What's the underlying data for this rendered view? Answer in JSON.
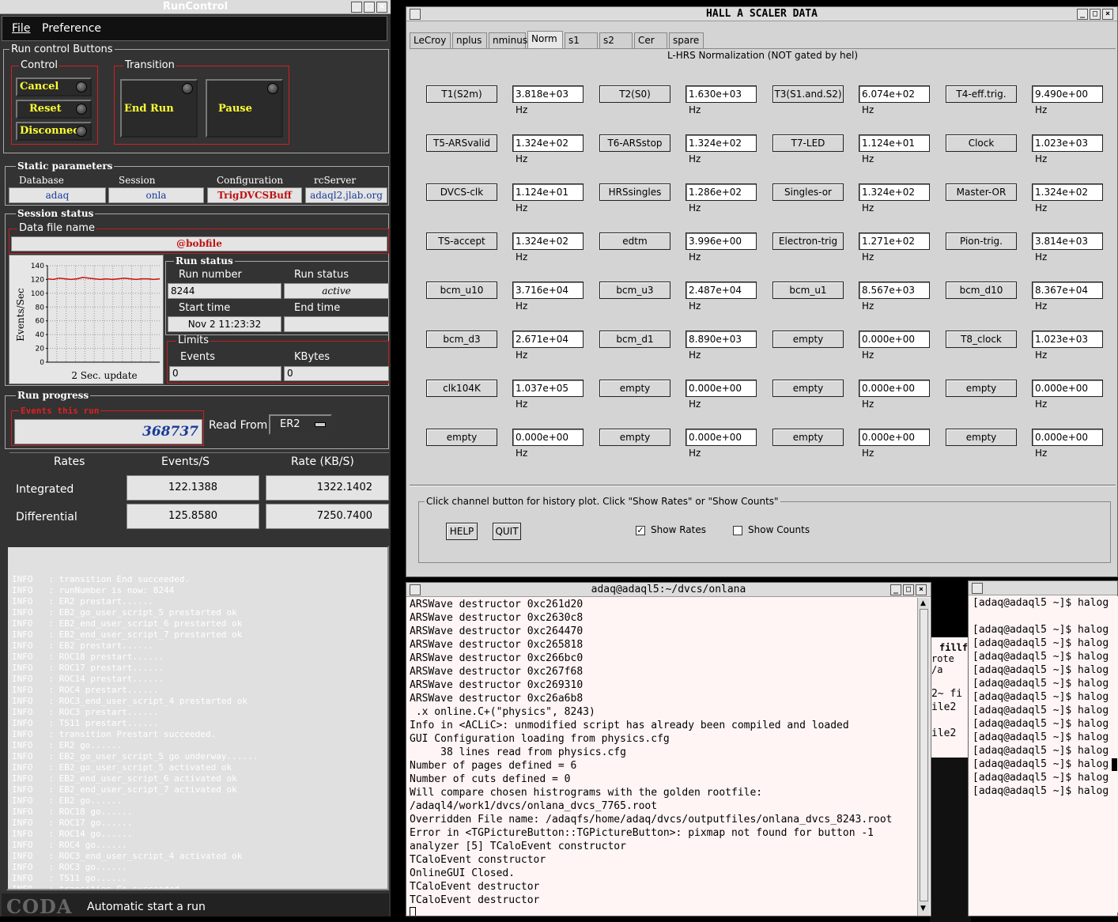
{
  "runcontrol": {
    "title": "RunControl",
    "menu": [
      "File",
      "Preference"
    ],
    "group_title": "Run control Buttons",
    "control_label": "Control",
    "transition_label": "Transition",
    "control_buttons": [
      "Cancel",
      "Reset",
      "Disconnect"
    ],
    "transition_buttons": [
      "End Run",
      "Pause"
    ],
    "static_params_title": "Static parameters",
    "params": [
      {
        "label": "Database",
        "value": "adaq"
      },
      {
        "label": "Session",
        "value": "onla"
      },
      {
        "label": "Configuration",
        "value": "TrigDVCSBuff"
      },
      {
        "label": "rcServer",
        "value": "adaql2.jlab.org"
      }
    ],
    "session_status_title": "Session status",
    "data_file_label": "Data file name",
    "data_file_value": "@bobfile",
    "chart_ylabel": "Events/Sec",
    "chart_xlabel": "2 Sec. update",
    "run_status_title": "Run status",
    "run_number_label": "Run number",
    "run_number_value": "8244",
    "run_status_label": "Run status",
    "run_status_value": "active",
    "start_time_label": "Start time",
    "start_time_value": "Nov 2 11:23:32",
    "end_time_label": "End time",
    "end_time_value": "",
    "limits_label": "Limits",
    "events_label": "Events",
    "events_value": "0",
    "kbytes_label": "KBytes",
    "kbytes_value": "0",
    "run_progress_title": "Run progress",
    "events_this_run_label": "Events this run",
    "events_this_run_value": "368737",
    "read_from_label": "Read From:",
    "read_from_value": "ER2",
    "rates_header": [
      "Rates",
      "Events/S",
      "Rate (KB/S)"
    ],
    "rates_rows": [
      {
        "label": "Integrated",
        "events": "122.1388",
        "rate": "1322.1402"
      },
      {
        "label": "Differential",
        "events": "125.8580",
        "rate": "7250.7400"
      }
    ],
    "log": [
      "INFO   : transition End succeeded.",
      "INFO   : runNumber is now: 8244",
      "INFO   : ER2 prestart......",
      "INFO   : EB2_go_user_script_5 prestarted ok",
      "INFO   : EB2_end_user_script_6 prestarted ok",
      "INFO   : EB2_end_user_script_7 prestarted ok",
      "INFO   : EB2 prestart......",
      "INFO   : ROC18 prestart......",
      "INFO   : ROC17 prestart......",
      "INFO   : ROC14 prestart......",
      "INFO   : ROC4 prestart......",
      "INFO   : ROC3_end_user_script_4 prestarted ok",
      "INFO   : ROC3 prestart......",
      "INFO   : TS11 prestart......",
      "INFO   : transition Prestart succeeded.",
      "INFO   : ER2 go......",
      "INFO   : EB2_go_user_script_5 go underway......",
      "INFO   : EB2_go_user_script_5 activated ok",
      "INFO   : EB2_end_user_script_6 activated ok",
      "INFO   : EB2_end_user_script_7 activated ok",
      "INFO   : EB2 go......",
      "INFO   : ROC18 go......",
      "INFO   : ROC17 go......",
      "INFO   : ROC14 go......",
      "INFO   : ROC4 go......",
      "INFO   : ROC3_end_user_script_4 activated ok",
      "INFO   : ROC3 go......",
      "INFO   : TS11 go......",
      "INFO   : transition Go succeeded."
    ],
    "coda_logo": "CODA",
    "status_message": "Automatic start a run"
  },
  "chart_data": {
    "type": "line",
    "title": "",
    "xlabel": "2 Sec. update",
    "ylabel": "Events/Sec",
    "ylim": [
      0,
      140
    ],
    "yticks": [
      0,
      20,
      40,
      60,
      80,
      100,
      120,
      140
    ],
    "grid": true,
    "series": [
      {
        "values": [
          121,
          120,
          122,
          121,
          120,
          121,
          123,
          122,
          121,
          120,
          121,
          120,
          121,
          122,
          121,
          120,
          121,
          121,
          120,
          121
        ]
      }
    ]
  },
  "scaler": {
    "title": "HALL  A  SCALER  DATA",
    "tabs": [
      "LeCroy",
      "nplus",
      "nminus",
      "Norm",
      "s1",
      "s2",
      "Cer",
      "spare"
    ],
    "active_tab": "Norm",
    "heading": "L-HRS Normalization (NOT gated by hel)",
    "rows": [
      [
        [
          "T1(S2m)",
          "3.818e+03 Hz"
        ],
        [
          "T2(S0)",
          "1.630e+03 Hz"
        ],
        [
          "T3(S1.and.S2)",
          "6.074e+02 Hz"
        ],
        [
          "T4-eff.trig.",
          "9.490e+00 Hz"
        ]
      ],
      [
        [
          "T5-ARSvalid",
          "1.324e+02 Hz"
        ],
        [
          "T6-ARSstop",
          "1.324e+02 Hz"
        ],
        [
          "T7-LED",
          "1.124e+01 Hz"
        ],
        [
          "Clock",
          "1.023e+03 Hz"
        ]
      ],
      [
        [
          "DVCS-clk",
          "1.124e+01 Hz"
        ],
        [
          "HRSsingles",
          "1.286e+02 Hz"
        ],
        [
          "Singles-or",
          "1.324e+02 Hz"
        ],
        [
          "Master-OR",
          "1.324e+02 Hz"
        ]
      ],
      [
        [
          "TS-accept",
          "1.324e+02 Hz"
        ],
        [
          "edtm",
          "3.996e+00 Hz"
        ],
        [
          "Electron-trig",
          "1.271e+02 Hz"
        ],
        [
          "Pion-trig.",
          "3.814e+03 Hz"
        ]
      ],
      [
        [
          "bcm_u10",
          "3.716e+04 Hz"
        ],
        [
          "bcm_u3",
          "2.487e+04 Hz"
        ],
        [
          "bcm_u1",
          "8.567e+03 Hz"
        ],
        [
          "bcm_d10",
          "8.367e+04 Hz"
        ]
      ],
      [
        [
          "bcm_d3",
          "2.671e+04 Hz"
        ],
        [
          "bcm_d1",
          "8.890e+03 Hz"
        ],
        [
          "empty",
          "0.000e+00 Hz"
        ],
        [
          "T8_clock",
          "1.023e+03 Hz"
        ]
      ],
      [
        [
          "clk104K",
          "1.037e+05 Hz"
        ],
        [
          "empty",
          "0.000e+00 Hz"
        ],
        [
          "empty",
          "0.000e+00 Hz"
        ],
        [
          "empty",
          "0.000e+00 Hz"
        ]
      ],
      [
        [
          "empty",
          "0.000e+00 Hz"
        ],
        [
          "empty",
          "0.000e+00 Hz"
        ],
        [
          "empty",
          "0.000e+00 Hz"
        ],
        [
          "empty",
          "0.000e+00 Hz"
        ]
      ]
    ],
    "footer_text": "Click channel button for history plot.  Click \"Show Rates\" or \"Show Counts\"",
    "help_label": "HELP",
    "quit_label": "QUIT",
    "show_rates_label": "Show Rates",
    "show_rates_checked": true,
    "show_counts_label": "Show Counts",
    "show_counts_checked": false
  },
  "terminal": {
    "title": "adaq@adaql5:~/dvcs/onlana",
    "lines": [
      "ARSWave destructor 0xc261d20",
      "ARSWave destructor 0xc2630c8",
      "ARSWave destructor 0xc264470",
      "ARSWave destructor 0xc265818",
      "ARSWave destructor 0xc266bc0",
      "ARSWave destructor 0xc267f68",
      "ARSWave destructor 0xc269310",
      "ARSWave destructor 0xc26a6b8",
      " .x online.C+(\"physics\", 8243)",
      "Info in <ACLiC>: unmodified script has already been compiled and loaded",
      "GUI Configuration loading from physics.cfg",
      "     38 lines read from physics.cfg",
      "Number of pages defined = 6",
      "Number of cuts defined = 0",
      "Will compare chosen histrograms with the golden rootfile:",
      "/adaql4/work1/dvcs/onlana_dvcs_7765.root",
      "Overridden File name: /adaqfs/home/adaq/dvcs/outputfiles/onlana_dvcs_8243.root",
      "Error in <TGPictureButton::TGPictureButton>: pixmap not found for button -1",
      "analyzer [5] TCaloEvent constructor",
      "TCaloEvent constructor",
      "OnlineGUI Closed.",
      "TCaloEvent destructor",
      "TCaloEvent destructor"
    ]
  },
  "behind": {
    "lines": [
      "fillf",
      "rote /a",
      "2~  fi",
      "ile2",
      "",
      "ile2"
    ]
  },
  "halog": {
    "lines": [
      "[adaq@adaql5 ~]$ halog",
      "",
      "[adaq@adaql5 ~]$ halog",
      "[adaq@adaql5 ~]$ halog",
      "[adaq@adaql5 ~]$ halog",
      "[adaq@adaql5 ~]$ halog",
      "[adaq@adaql5 ~]$ halog",
      "[adaq@adaql5 ~]$ halog",
      "[adaq@adaql5 ~]$ halog",
      "[adaq@adaql5 ~]$ halog",
      "[adaq@adaql5 ~]$ halog",
      "[adaq@adaql5 ~]$ halog",
      "[adaq@adaql5 ~]$ halog",
      "[adaq@adaql5 ~]$ halog",
      "[adaq@adaql5 ~]$ halog"
    ]
  }
}
